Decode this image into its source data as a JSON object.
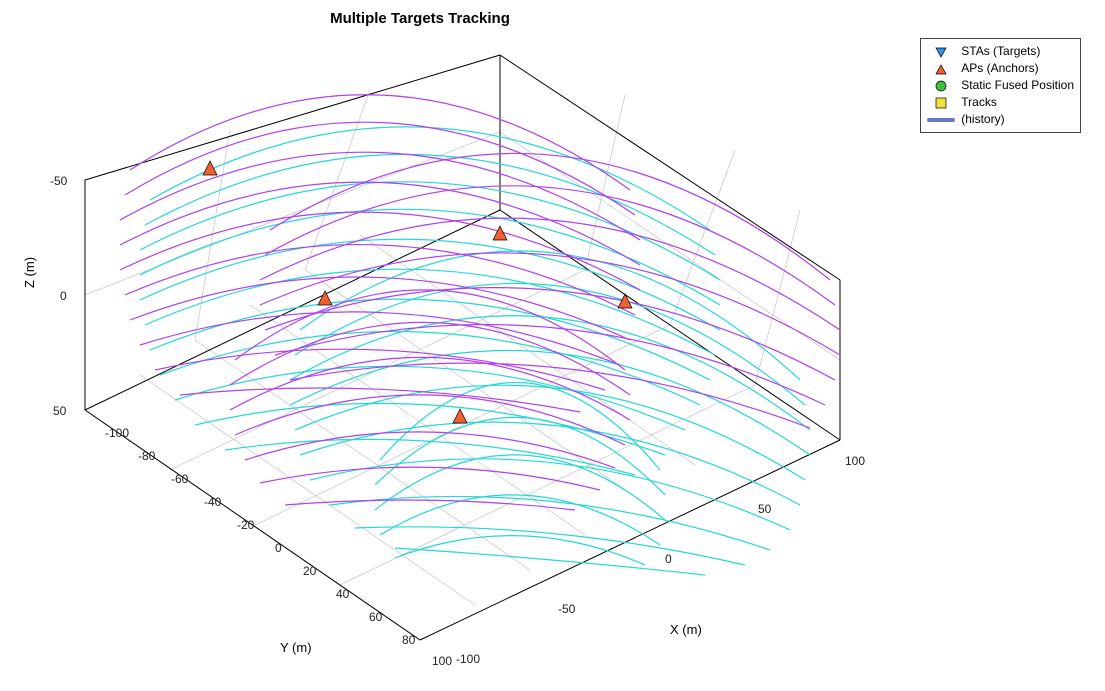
{
  "chart_data": {
    "type": "scatter",
    "title": "Multiple Targets Tracking",
    "xlabel": "X (m)",
    "ylabel": "Y (m)",
    "zlabel": "Z (m)",
    "xlim": [
      -100,
      100
    ],
    "ylim": [
      -100,
      100
    ],
    "zlim": [
      -50,
      50
    ],
    "x_ticks": [
      -100,
      -50,
      0,
      50,
      100
    ],
    "y_ticks": [
      -100,
      -80,
      -60,
      -40,
      -20,
      0,
      20,
      40,
      60,
      80,
      100
    ],
    "z_ticks": [
      -50,
      0,
      50
    ],
    "legend": {
      "entries": [
        "STAs (Targets)",
        "APs (Anchors)",
        "Static Fused Position",
        "Tracks",
        "(history)"
      ]
    },
    "series": [
      {
        "name": "APs (Anchors)",
        "marker": "triangle-up",
        "color": "#f06030",
        "points_xyz": [
          [
            -40,
            -60,
            -30
          ],
          [
            -30,
            -20,
            0
          ],
          [
            10,
            -40,
            -35
          ],
          [
            40,
            -10,
            0
          ],
          [
            5,
            30,
            25
          ]
        ]
      },
      {
        "name": "STAs (Targets)",
        "marker": "triangle-down",
        "color": "#3090f0",
        "points_xyz": []
      },
      {
        "name": "Static Fused Position",
        "marker": "circle",
        "color": "#40c040",
        "points_xyz": []
      },
      {
        "name": "Tracks",
        "marker": "square",
        "color": "#f0e040",
        "points_xyz": []
      },
      {
        "name": "(history)",
        "marker": "line",
        "color": "#6778c4"
      }
    ],
    "detection_spheres": {
      "note": "range-detection wireframe spheres (one per AP per target range); rendered as cyan/magenta arcs",
      "colors": [
        "#25d8d5",
        "#b040f0"
      ],
      "count_approx": 10
    }
  }
}
